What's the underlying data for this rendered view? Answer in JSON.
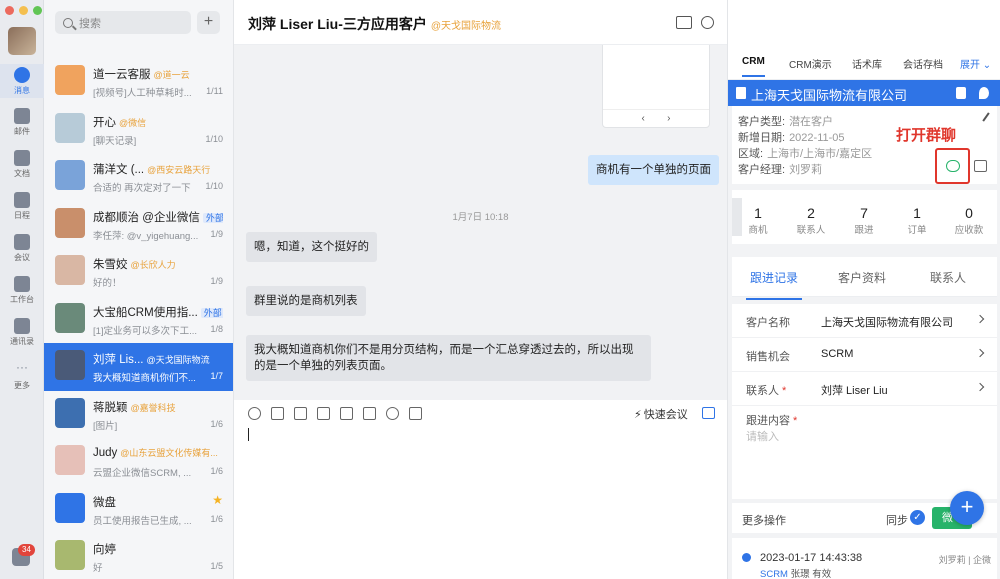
{
  "search": {
    "placeholder": "搜索"
  },
  "rail": {
    "items": [
      {
        "label": "消息"
      },
      {
        "label": "邮件"
      },
      {
        "label": "文档"
      },
      {
        "label": "日程"
      },
      {
        "label": "会议"
      },
      {
        "label": "工作台"
      },
      {
        "label": "通讯录"
      },
      {
        "label": "更多"
      }
    ],
    "badge": "34"
  },
  "conversations": [
    {
      "name": "道一云客服",
      "org": "@道一云",
      "preview": "[视频号]人工种草耗时...",
      "count": "1/11",
      "color": "#f0a35e"
    },
    {
      "name": "开心",
      "org": "@微信",
      "preview": "[聊天记录]",
      "count": "1/10",
      "color": "#b7cbd8"
    },
    {
      "name": "蒲洋文 (...",
      "org": "@西安云路天行",
      "preview": "合适的 再次定对了一下",
      "count": "1/10",
      "color": "#7aa3d9"
    },
    {
      "name": "成都顺治 @企业微信",
      "tag": "外部",
      "preview": "李任萍: @v_yigehuang...",
      "count": "1/9",
      "color": "#c98f6b"
    },
    {
      "name": "朱雪姣",
      "org": "@长欣人力",
      "preview": "好的！",
      "count": "1/9",
      "color": "#d9b7a4"
    },
    {
      "name": "大宝船CRM使用指...",
      "tag": "外部",
      "preview": "[1]定业务可以多次下工...",
      "count": "1/8",
      "color": "#6a8a7a"
    },
    {
      "name": "刘萍 Lis...",
      "org": "@天戈国际物流",
      "preview": "我大概知道商机你们不...",
      "count": "1/7",
      "color": "#4a5a78"
    },
    {
      "name": "蒋脱颖",
      "org": "@嘉誉科技",
      "preview": "[图片]",
      "count": "1/6",
      "color": "#3d6fb0"
    },
    {
      "name": "Judy",
      "org": "@山东云盟文化传媒有...",
      "preview": "云盟企业微信SCRM, ...",
      "count": "1/6",
      "color": "#e6c0b8"
    },
    {
      "name": "微盘",
      "preview": "员工使用报告已生成, ...",
      "count": "1/6",
      "color": "#2f74e6"
    },
    {
      "name": "向婷",
      "preview": "好",
      "count": "1/5",
      "color": "#a8b86f"
    }
  ],
  "chat": {
    "title": "刘萍 Liser Liu-三方应用客户",
    "org": "@天戈国际物流",
    "time": "1月7日 10:18",
    "messages": [
      {
        "text": "商机有一个单独的页面"
      },
      {
        "text": "嗯，知道，这个挺好的"
      },
      {
        "text": "群里说的是商机列表"
      },
      {
        "text": "我大概知道商机你们不是用分页结构，而是一个汇总穿透过去的，所以出现的是一个单独的列表页面。"
      }
    ],
    "quick_meeting": "快速会议"
  },
  "crm": {
    "tabs": [
      "CRM",
      "CRM演示",
      "话术库",
      "会话存档"
    ],
    "expand": "展开",
    "company": "上海天戈国际物流有限公司",
    "details": [
      {
        "k": "客户类型:",
        "v": "潜在客户"
      },
      {
        "k": "新增日期:",
        "v": "2022-11-05"
      },
      {
        "k": "区域:",
        "v": "上海市/上海市/嘉定区"
      },
      {
        "k": "客户经理:",
        "v": "刘罗莉"
      }
    ],
    "callout": "打开群聊",
    "stats": [
      {
        "n": "1",
        "l": "商机"
      },
      {
        "n": "2",
        "l": "联系人"
      },
      {
        "n": "7",
        "l": "跟进"
      },
      {
        "n": "1",
        "l": "订单"
      },
      {
        "n": "0",
        "l": "应收款"
      }
    ],
    "subtabs": [
      "跟进记录",
      "客户资料",
      "联系人"
    ],
    "form": [
      {
        "k": "客户名称",
        "v": "上海天戈国际物流有限公司",
        "req": ""
      },
      {
        "k": "销售机会",
        "v": "SCRM",
        "req": ""
      },
      {
        "k": "联系人",
        "v": "刘萍 Liser Liu",
        "req": "*"
      }
    ],
    "followup_label": "跟进内容",
    "followup_placeholder": "请输入",
    "more_actions": "更多操作",
    "sync": "同步",
    "send": "微",
    "log": {
      "ts": "2023-01-17 14:43:38",
      "who": "刘罗莉 | 企微",
      "tag": "SCRM",
      "sub": "张璟 有效"
    }
  }
}
